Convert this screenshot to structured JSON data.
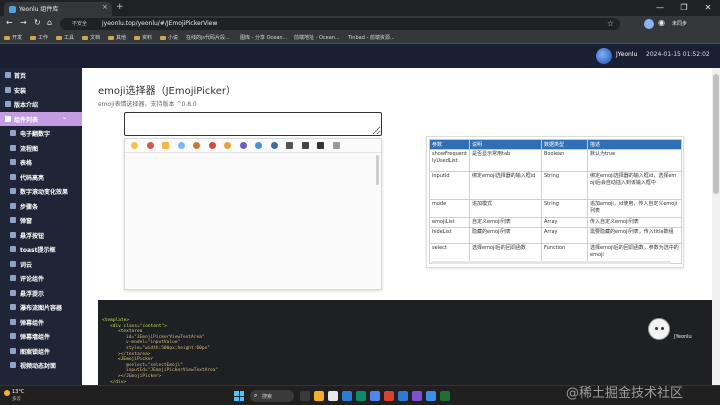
{
  "browser": {
    "tab_title": "Yeonlu 组件库",
    "tab_close": "×",
    "new_tab": "+",
    "window_buttons": [
      "—",
      "❐",
      "✕"
    ],
    "secure_label": "不安全",
    "url": "jyeonlu.top/yeonlu/#/JEmojiPickerView",
    "profile_label": "未同步"
  },
  "bookmarks": [
    {
      "label": "开发"
    },
    {
      "label": "工作"
    },
    {
      "label": "工具"
    },
    {
      "label": "文档"
    },
    {
      "label": "其他"
    },
    {
      "label": "资料"
    },
    {
      "label": "小说"
    },
    {
      "label": "在线的js代码片段..."
    },
    {
      "label": "图库 - 分享 Ocean..."
    },
    {
      "label": "前端地址 - Ocean..."
    },
    {
      "label": "Tinbad - 前端资源..."
    }
  ],
  "header": {
    "user_name": "JYeonlu",
    "clock": "2024-01-15 01:52:02"
  },
  "sidebar": {
    "items": [
      {
        "label": "首页",
        "sub": false,
        "active": false
      },
      {
        "label": "安装",
        "sub": false,
        "active": false
      },
      {
        "label": "版本介绍",
        "sub": false,
        "active": false
      },
      {
        "label": "组件列表",
        "sub": false,
        "active": true
      },
      {
        "label": "电子翻数字",
        "sub": true,
        "active": false
      },
      {
        "label": "流程图",
        "sub": true,
        "active": false
      },
      {
        "label": "表格",
        "sub": true,
        "active": false
      },
      {
        "label": "代码高亮",
        "sub": true,
        "active": false
      },
      {
        "label": "数字滚动变化效果",
        "sub": true,
        "active": false
      },
      {
        "label": "步骤条",
        "sub": true,
        "active": false
      },
      {
        "label": "弹窗",
        "sub": true,
        "active": false
      },
      {
        "label": "悬浮按钮",
        "sub": true,
        "active": false
      },
      {
        "label": "toast提示框",
        "sub": true,
        "active": false
      },
      {
        "label": "词云",
        "sub": true,
        "active": false
      },
      {
        "label": "评论组件",
        "sub": true,
        "active": false
      },
      {
        "label": "悬浮提示",
        "sub": true,
        "active": false
      },
      {
        "label": "瀑布流图片容器",
        "sub": true,
        "active": false
      },
      {
        "label": "弹幕组件",
        "sub": true,
        "active": false
      },
      {
        "label": "弹幕墙组件",
        "sub": true,
        "active": false
      },
      {
        "label": "图案锁组件",
        "sub": true,
        "active": false
      },
      {
        "label": "视频动态封面",
        "sub": true,
        "active": false
      }
    ]
  },
  "main": {
    "title": "emoji选择器（JEmojiPicker）",
    "subtitle": "emoji表情选择器，支持版本 ^0.8.0",
    "emoji_tab_colors": [
      "#f5c542",
      "#d9534f",
      "#f0b64a",
      "#7fb3ff",
      "#cc7a2e",
      "#d44a3a",
      "#e8a23a",
      "#6a5acd",
      "#4a90d9",
      "#3a6ea5",
      "#555555",
      "#444444",
      "#333333",
      "#999999"
    ]
  },
  "props_table": {
    "headers": [
      "参数",
      "说明",
      "数据类型",
      "描述"
    ],
    "rows": [
      [
        "showFrequentlyUsedList",
        "是否显示常用tab",
        "Boolean",
        "默认为true"
      ],
      [
        "inputId",
        "绑定emoji选择器的输入框id",
        "String",
        "绑定emoji选择器的输入框id，选择emoji后会自动插入到该输入框中"
      ],
      [
        "mode",
        "追加模式",
        "String",
        "追加emoji，id使用，传入自定义emoji列表"
      ],
      [
        "emojiList",
        "自定义emoji列表",
        "Array",
        "传入自定义emoji列表"
      ],
      [
        "hideList",
        "隐藏的emoji列表",
        "Array",
        "需要隐藏的emoji列表，传入title数组"
      ],
      [
        "select",
        "选择emoji后的回调函数",
        "Function",
        "选择emoji后的回调函数，参数为选中的emoji"
      ]
    ]
  },
  "code": {
    "lines": [
      {
        "indent": 0,
        "text": "<template>"
      },
      {
        "indent": 1,
        "text": "<div class=\"content\">"
      },
      {
        "indent": 2,
        "text": "<textarea"
      },
      {
        "indent": 3,
        "text": "id=\"JEmojiPickerViewTextArea\""
      },
      {
        "indent": 3,
        "text": "v-model=\"inputValue\""
      },
      {
        "indent": 3,
        "text": "style=\"width:500px;height:60px\""
      },
      {
        "indent": 2,
        "text": "></textarea>"
      },
      {
        "indent": 2,
        "text": "<JEmojiPicker"
      },
      {
        "indent": 3,
        "text": "@select=\"selectEmoji\""
      },
      {
        "indent": 3,
        "text": "inputId=\"JEmojiPickerViewTextArea\""
      },
      {
        "indent": 2,
        "text": "></JEmojiPicker>"
      },
      {
        "indent": 1,
        "text": "</div>"
      }
    ],
    "mascot_label": "JYeonlu"
  },
  "taskbar": {
    "temp": "13°C",
    "weather": "多云",
    "search_label": "搜索",
    "app_colors": [
      "#3a3a3a",
      "#f5b026",
      "#e8e8e8",
      "#2b7cd3",
      "#0f8a6a",
      "#4e86f0",
      "#d9402e",
      "#2d7ad6",
      "#7a52d1",
      "#3d8ee8",
      "#1f6f2f"
    ]
  },
  "watermark": "@稀土掘金技术社区"
}
